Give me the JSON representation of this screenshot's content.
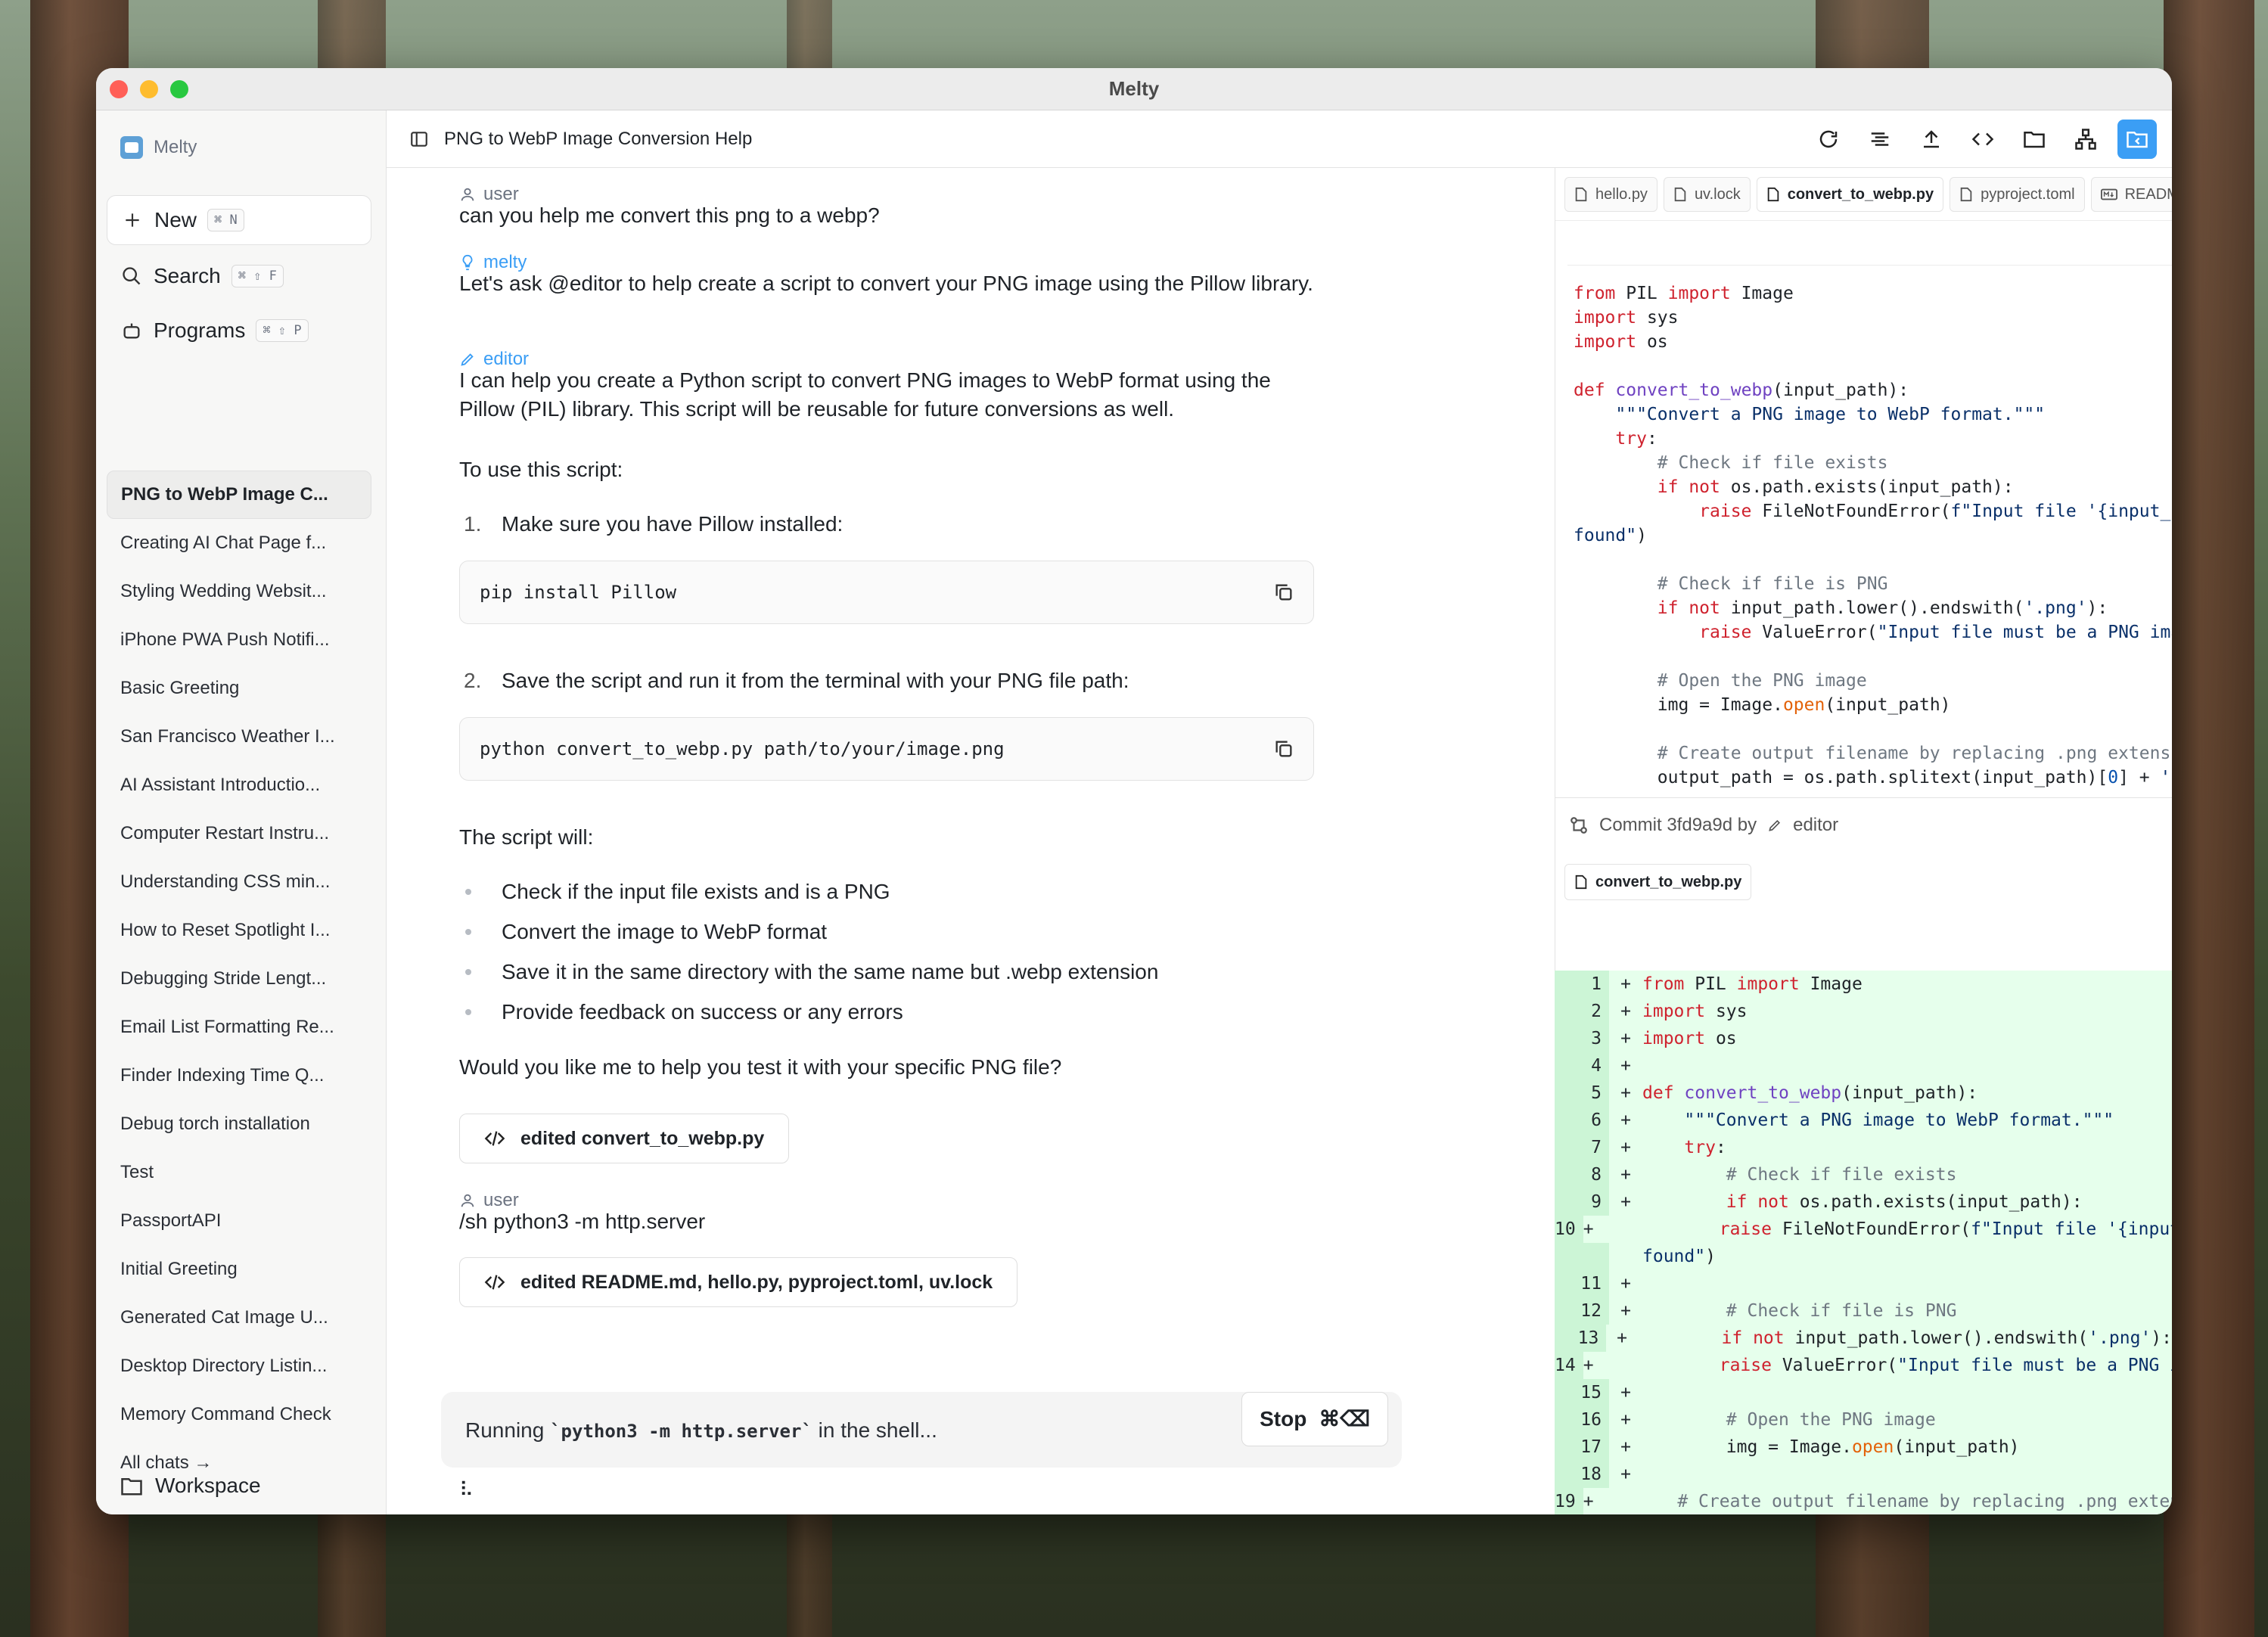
{
  "window": {
    "title": "Melty"
  },
  "sidebar": {
    "brand": "Melty",
    "new": {
      "label": "New",
      "shortcut": "⌘ N"
    },
    "search": {
      "label": "Search",
      "shortcut": "⌘ ⇧ F"
    },
    "programs": {
      "label": "Programs",
      "shortcut": "⌘ ⇧ P"
    },
    "chats": [
      "PNG to WebP Image C...",
      "Creating AI Chat Page f...",
      "Styling Wedding Websit...",
      "iPhone PWA Push Notifi...",
      "Basic Greeting",
      "San Francisco Weather I...",
      "AI Assistant Introductio...",
      "Computer Restart Instru...",
      "Understanding CSS min...",
      "How to Reset Spotlight I...",
      "Debugging Stride Lengt...",
      "Email List Formatting Re...",
      "Finder Indexing Time Q...",
      "Debug torch installation",
      "Test",
      "PassportAPI",
      "Initial Greeting",
      "Generated Cat Image U...",
      "Desktop Directory Listin...",
      "Memory Command Check"
    ],
    "all_chats": "All chats →",
    "workspace": "Workspace"
  },
  "header": {
    "title": "PNG to WebP Image Conversion Help"
  },
  "conversation": {
    "user1_role": "user",
    "user1_text": "can you help me convert this png to a webp?",
    "melty_role": "melty",
    "melty_text": "Let's ask @editor to help create a script to convert your PNG image using the Pillow library.",
    "editor_role": "editor",
    "editor_text": "I can help you create a Python script to convert PNG images to WebP format using the Pillow (PIL) library. This script will be reusable for future conversions as well.",
    "to_use": "To use this script:",
    "step1_num": "1.",
    "step1": "Make sure you have Pillow installed:",
    "code1": "pip install Pillow",
    "step2_num": "2.",
    "step2": "Save the script and run it from the terminal with your PNG file path:",
    "code2": "python convert_to_webp.py path/to/your/image.png",
    "script_will": "The script will:",
    "bullets": [
      "Check if the input file exists and is a PNG",
      "Convert the image to WebP format",
      "Save it in the same directory with the same name but .webp extension",
      "Provide feedback on success or any errors"
    ],
    "question": "Would you like me to help you test it with your specific PNG file?",
    "edited1": "edited convert_to_webp.py",
    "user2_role": "user",
    "user2_text": "/sh python3 -m http.server",
    "edited2": "edited README.md, hello.py, pyproject.toml, uv.lock",
    "running_prefix": "Running ",
    "running_cmd": "`python3 -m http.server`",
    "running_suffix": " in the shell...",
    "stop_label": "Stop",
    "stop_shortcut": "⌘⌫",
    "spinner": "⠧"
  },
  "files": {
    "tabs": [
      "hello.py",
      "uv.lock",
      "convert_to_webp.py",
      "pyproject.toml",
      "README.md"
    ],
    "active_tab": "convert_to_webp.py"
  },
  "commit": {
    "label": "Commit 3fd9a9d by",
    "author": "editor",
    "file": "convert_to_webp.py"
  },
  "colors": {
    "accent": "#3b9ef5",
    "diff_bg": "#e6ffec",
    "keyword": "#cf222e",
    "function": "#6f42c1"
  }
}
